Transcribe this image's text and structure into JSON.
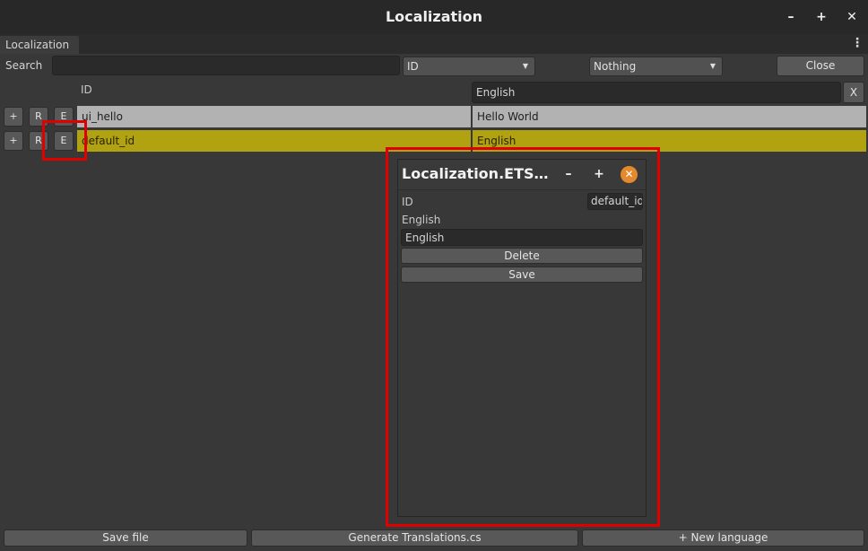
{
  "window": {
    "title": "Localization",
    "minimize_label": "–",
    "maximize_label": "+",
    "close_label": "✕"
  },
  "tabs": [
    {
      "label": "Localization"
    }
  ],
  "tab_menu_label": "⋮",
  "toolbar": {
    "search_label": "Search",
    "search_value": "",
    "key_dropdown": "ID",
    "filter_dropdown": "Nothing",
    "close_label": "Close"
  },
  "table": {
    "id_header": "ID",
    "language_header_value": "English",
    "remove_language_label": "X",
    "row_buttons": {
      "add": "+",
      "remove": "R",
      "edit": "E"
    },
    "rows": [
      {
        "id": "ui_hello",
        "english": "Hello World"
      },
      {
        "id": "default_id",
        "english": "English"
      }
    ]
  },
  "editor": {
    "title": "Localization.ETSEdit...",
    "minimize_label": "–",
    "maximize_label": "+",
    "close_label": "✕",
    "id_label": "ID",
    "id_value": "default_id",
    "english_label": "English",
    "english_value": "English",
    "delete_label": "Delete",
    "save_label": "Save"
  },
  "footer": {
    "save_file_label": "Save file",
    "generate_label": "Generate Translations.cs",
    "new_language_label": "+ New language"
  },
  "colors": {
    "background": "#383838",
    "titlebar": "#282828",
    "row_normal": "#b2b2b2",
    "row_selected": "#b0a210",
    "close_accent": "#e58a2c",
    "highlight": "#e00000"
  }
}
